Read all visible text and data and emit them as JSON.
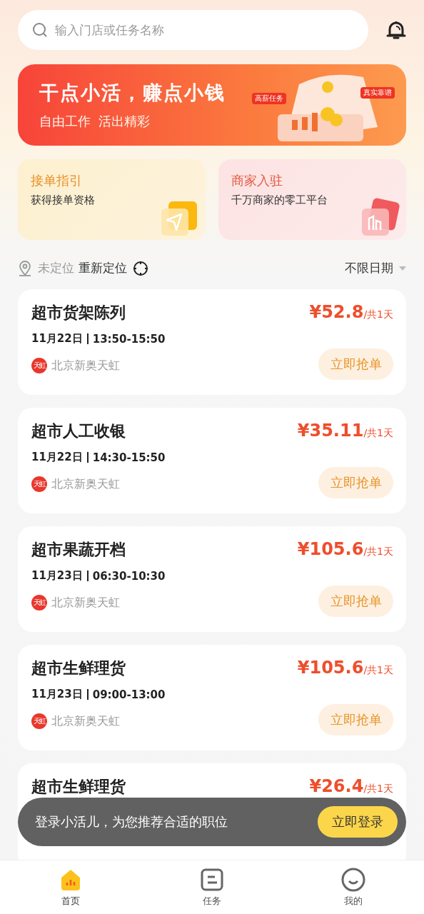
{
  "search": {
    "placeholder": "输入门店或任务名称"
  },
  "banner": {
    "title": "干点小活，赚点小钱",
    "subtitle": "自由工作  活出精彩",
    "tags": [
      "高薪任务",
      "真实靠谱"
    ]
  },
  "entries": [
    {
      "kind": "guide",
      "title": "接单指引",
      "subtitle": "获得接单资格"
    },
    {
      "kind": "merchant",
      "title": "商家入驻",
      "subtitle": "千万商家的零工平台"
    }
  ],
  "location": {
    "status": "未定位",
    "action": "重新定位",
    "date_filter": "不限日期"
  },
  "jobs": [
    {
      "title": "超市货架陈列",
      "price": "¥52.8",
      "unit": "/共1天",
      "date": "11月22日",
      "time": "13:50-15:50",
      "logo": "天虹",
      "store": "北京新奥天虹",
      "button": "立即抢单"
    },
    {
      "title": "超市人工收银",
      "price": "¥35.11",
      "unit": "/共1天",
      "date": "11月22日",
      "time": "14:30-15:50",
      "logo": "天虹",
      "store": "北京新奥天虹",
      "button": "立即抢单"
    },
    {
      "title": "超市果蔬开档",
      "price": "¥105.6",
      "unit": "/共1天",
      "date": "11月23日",
      "time": "06:30-10:30",
      "logo": "天虹",
      "store": "北京新奥天虹",
      "button": "立即抢单"
    },
    {
      "title": "超市生鲜理货",
      "price": "¥105.6",
      "unit": "/共1天",
      "date": "11月23日",
      "time": "09:00-13:00",
      "logo": "天虹",
      "store": "北京新奥天虹",
      "button": "立即抢单"
    },
    {
      "title": "超市生鲜理货",
      "price": "¥26.4",
      "unit": "/共1天"
    }
  ],
  "toast": {
    "message": "登录小活儿，为您推荐合适的职位",
    "button": "立即登录"
  },
  "tabs": [
    {
      "kind": "home",
      "label": "首页",
      "selected": true
    },
    {
      "kind": "tasks",
      "label": "任务",
      "selected": false
    },
    {
      "kind": "me",
      "label": "我的",
      "selected": false
    }
  ]
}
